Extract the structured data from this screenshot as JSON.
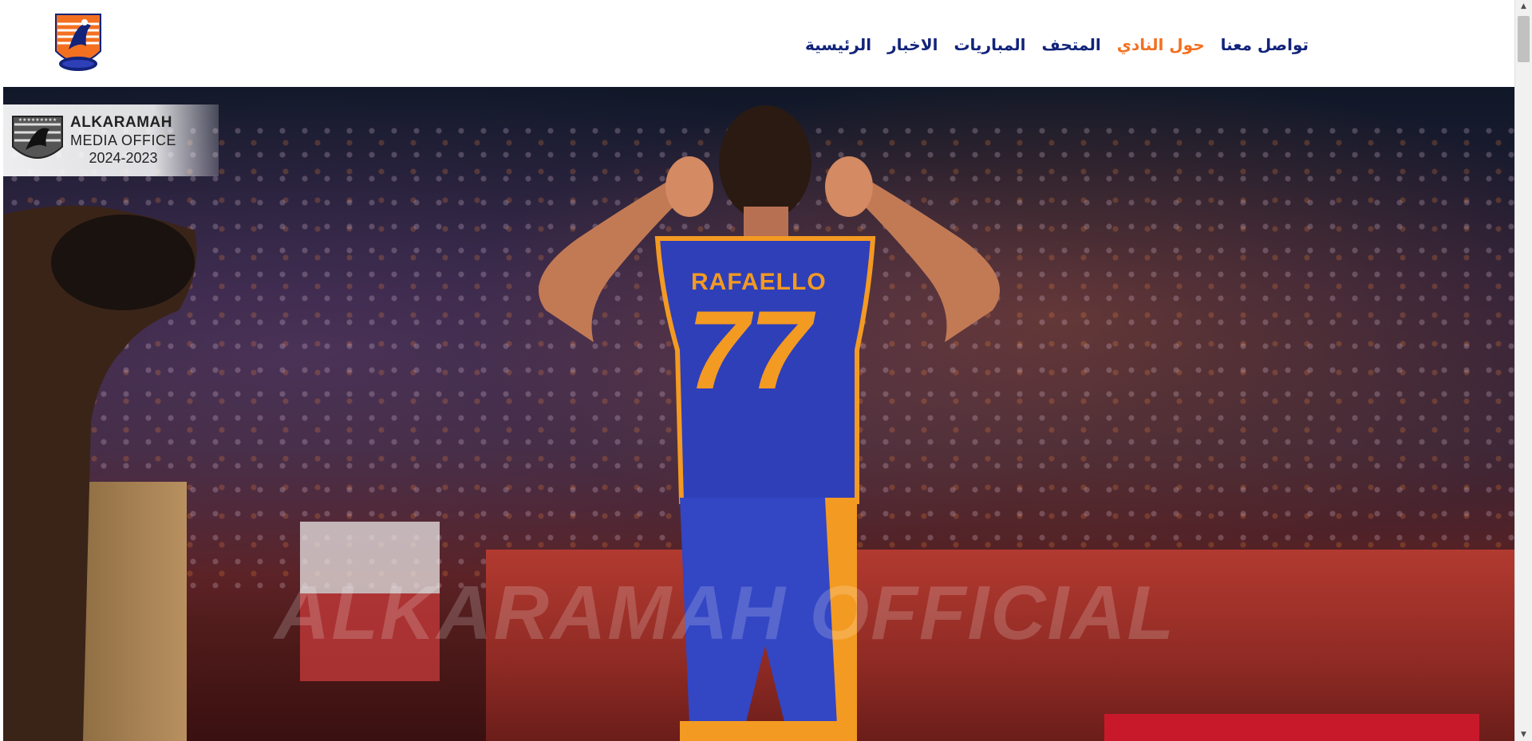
{
  "nav": {
    "items": [
      {
        "label": "الرئيسية",
        "active": false
      },
      {
        "label": "الاخبار",
        "active": false
      },
      {
        "label": "المباريات",
        "active": false
      },
      {
        "label": "المتحف",
        "active": false
      },
      {
        "label": "حول النادي",
        "active": true
      },
      {
        "label": "تواصل معنا",
        "active": false
      }
    ]
  },
  "hero": {
    "badge": {
      "line1": "ALKARAMAH",
      "line2": "MEDIA OFFICE",
      "line3": "2024-2023"
    },
    "jersey_name": "RAFAELLO",
    "jersey_number": "77",
    "watermark": "ALKARAMAH OFFICIAL"
  },
  "colors": {
    "nav_text": "#12237a",
    "nav_active": "#f37021",
    "jersey_blue": "#2f3fb8",
    "jersey_orange": "#f39a22"
  },
  "icons": {
    "logo": "club-eagle-logo",
    "scroll_up": "chevron-up-icon",
    "scroll_down": "chevron-down-icon"
  }
}
